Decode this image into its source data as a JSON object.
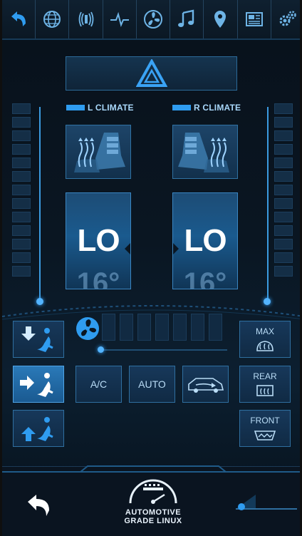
{
  "topbar": {
    "items": [
      {
        "icon": "back-arrow-icon"
      },
      {
        "icon": "globe-icon"
      },
      {
        "icon": "radio-waves-icon"
      },
      {
        "icon": "heartbeat-icon"
      },
      {
        "icon": "fan-icon"
      },
      {
        "icon": "music-note-icon"
      },
      {
        "icon": "map-pin-icon"
      },
      {
        "icon": "newspaper-icon"
      },
      {
        "icon": "settings-gears-icon"
      }
    ]
  },
  "hazard": {
    "icon": "hazard-triangle-icon"
  },
  "climate": {
    "left": {
      "label": "L CLIMATE",
      "temp_mode": "LO",
      "temp_value": "16°"
    },
    "right": {
      "label": "R CLIMATE",
      "temp_mode": "LO",
      "temp_value": "16°"
    }
  },
  "buttons": {
    "ac": "A/C",
    "auto": "AUTO",
    "max": "MAX",
    "rear": "REAR",
    "front": "FRONT"
  },
  "footer": {
    "brand_line1": "AUTOMOTIVE",
    "brand_line2": "GRADE LINUX"
  },
  "colors": {
    "accent": "#2f9cf0",
    "panel": "#17385a",
    "background": "#0a1622"
  }
}
